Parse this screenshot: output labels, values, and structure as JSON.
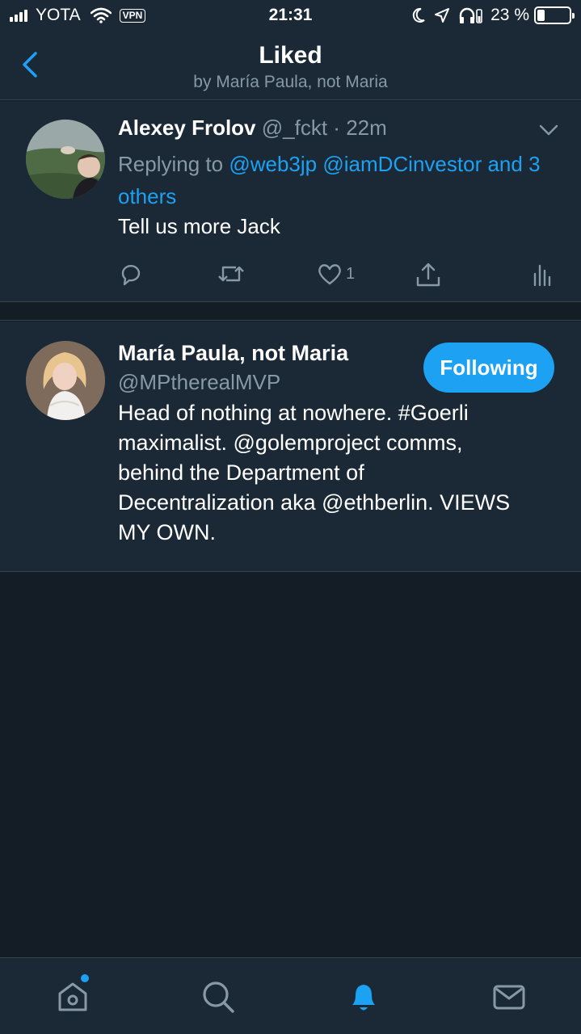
{
  "status_bar": {
    "carrier": "YOTA",
    "vpn": "VPN",
    "time": "21:31",
    "battery_text": "23 %",
    "battery_level": 0.23,
    "icons": [
      "signal-icon",
      "wifi-icon",
      "moon-icon",
      "location-icon",
      "headphones-icon",
      "battery-icon"
    ]
  },
  "header": {
    "title": "Liked",
    "subtitle": "by María Paula, not Maria",
    "back_icon": "chevron-left-icon"
  },
  "tweet": {
    "author_name": "Alexey Frolov",
    "author_handle": "@_fckt",
    "separator": "·",
    "time_ago": "22m",
    "replying_to_label": "Replying to",
    "mentions": [
      "@web3jp",
      "@iamDCinvestor"
    ],
    "and_others": "and 3 others",
    "text": "Tell us more Jack",
    "like_count": "1",
    "actions": [
      "reply-icon",
      "retweet-icon",
      "like-icon",
      "share-icon",
      "analytics-icon"
    ]
  },
  "user_card": {
    "name": "María Paula, not Maria",
    "handle": "@MPtherealMVP",
    "follow_button": "Following",
    "bio_lines": [
      "Head of nothing at nowhere. #Goerli",
      "maximalist. @golemproject comms,",
      "behind the Department of",
      "Decentralization aka @ethberlin. VIEWS",
      "MY OWN."
    ]
  },
  "tab_bar": {
    "tabs": [
      "home-icon",
      "search-icon",
      "notifications-icon",
      "messages-icon"
    ],
    "active": "notifications-icon",
    "accent": "#1da1f2"
  },
  "colors": {
    "background": "#141d26",
    "card": "#1b2836",
    "muted": "#8899a6",
    "accent": "#1da1f2",
    "divider": "#38444d"
  }
}
